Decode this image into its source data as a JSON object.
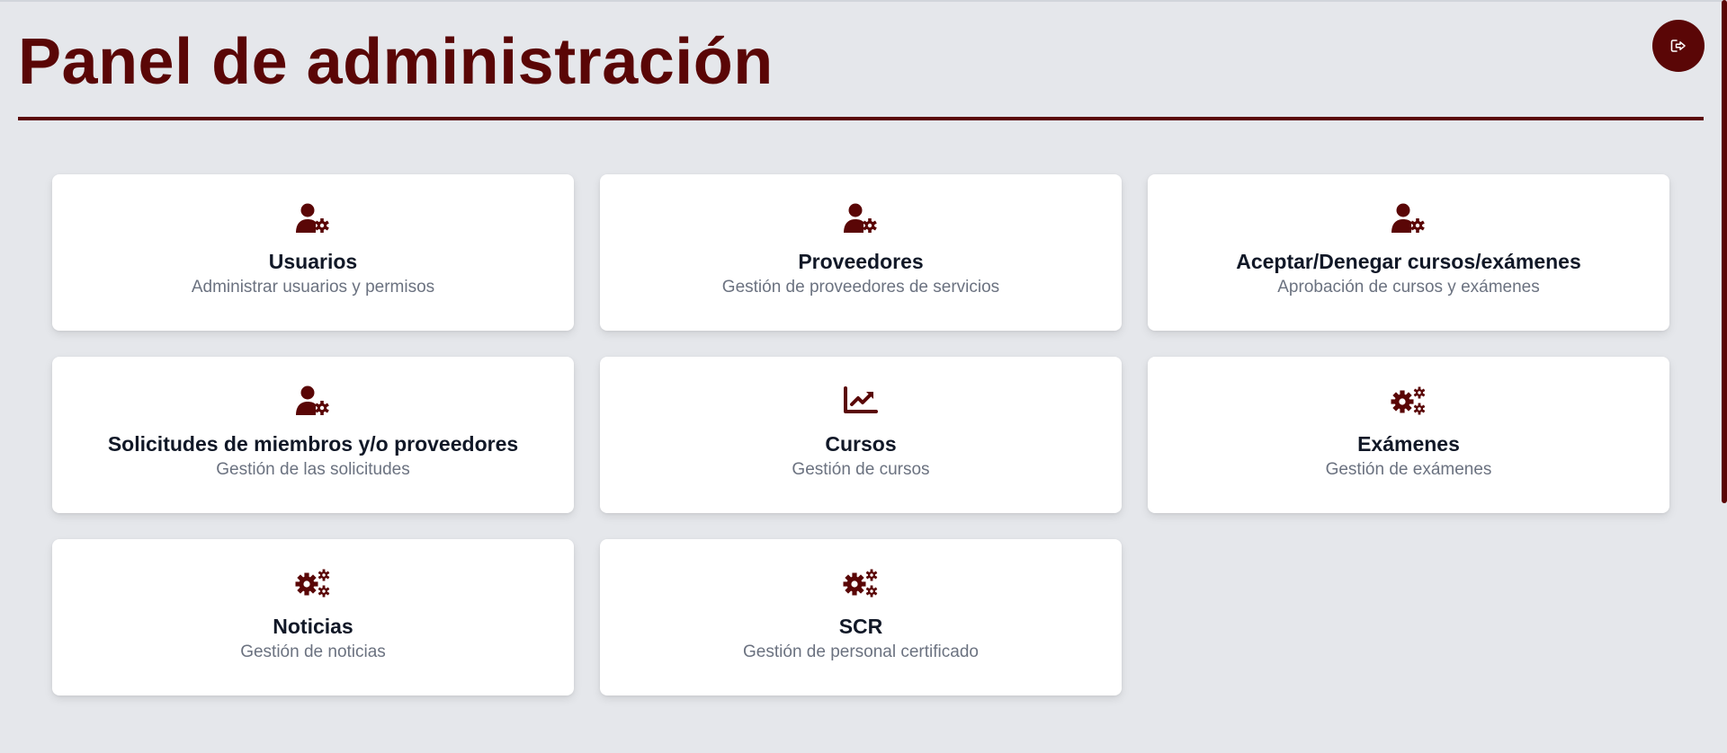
{
  "header": {
    "title": "Panel de administración",
    "logout_icon": "logout-icon"
  },
  "colors": {
    "accent": "#5a0606",
    "background": "#e5e7eb",
    "card": "#ffffff",
    "title_text": "#111827",
    "desc_text": "#6b7280"
  },
  "cards": [
    {
      "icon": "user-gear-icon",
      "title": "Usuarios",
      "description": "Administrar usuarios y permisos"
    },
    {
      "icon": "user-gear-icon",
      "title": "Proveedores",
      "description": "Gestión de proveedores de servicios"
    },
    {
      "icon": "user-gear-icon",
      "title": "Aceptar/Denegar cursos/exámenes",
      "description": "Aprobación de cursos y exámenes"
    },
    {
      "icon": "user-gear-icon",
      "title": "Solicitudes de miembros y/o proveedores",
      "description": "Gestión de las solicitudes"
    },
    {
      "icon": "chart-line-icon",
      "title": "Cursos",
      "description": "Gestión de cursos"
    },
    {
      "icon": "gears-icon",
      "title": "Exámenes",
      "description": "Gestión de exámenes"
    },
    {
      "icon": "gears-icon",
      "title": "Noticias",
      "description": "Gestión de noticias"
    },
    {
      "icon": "gears-icon",
      "title": "SCR",
      "description": "Gestión de personal certificado"
    }
  ]
}
